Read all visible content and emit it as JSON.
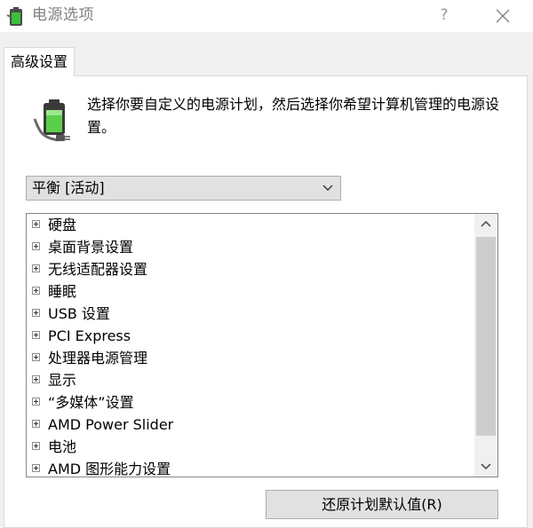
{
  "window": {
    "title": "电源选项",
    "help_label": "?",
    "close_label": "✕",
    "icon": "power-options-icon"
  },
  "tabs": [
    {
      "label": "高级设置",
      "selected": true
    }
  ],
  "description": {
    "icon": "battery-plug-icon",
    "text": "选择你要自定义的电源计划，然后选择你希望计算机管理的电源设置。"
  },
  "plan_select": {
    "value": "平衡 [活动]",
    "icon": "chevron-down-icon"
  },
  "settings_tree": {
    "items": [
      {
        "label": "硬盘"
      },
      {
        "label": "桌面背景设置"
      },
      {
        "label": "无线适配器设置"
      },
      {
        "label": "睡眠"
      },
      {
        "label": "USB 设置"
      },
      {
        "label": "PCI Express"
      },
      {
        "label": "处理器电源管理"
      },
      {
        "label": "显示"
      },
      {
        "label": "“多媒体”设置"
      },
      {
        "label": "AMD Power Slider"
      },
      {
        "label": "电池"
      },
      {
        "label": "AMD 图形能力设置"
      }
    ]
  },
  "buttons": {
    "restore_defaults": "还原计划默认值(R)"
  }
}
